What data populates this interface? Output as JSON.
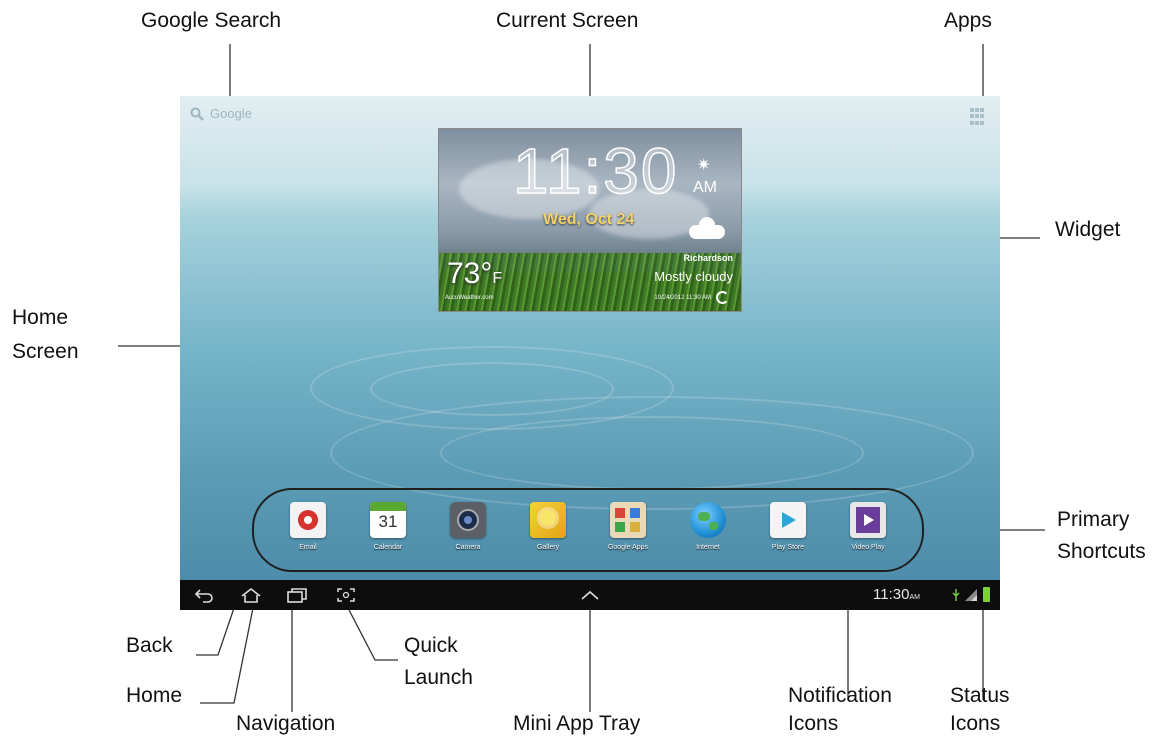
{
  "callouts": {
    "google_search": "Google Search",
    "current_screen": "Current Screen",
    "apps": "Apps",
    "widget": "Widget",
    "home_screen_1": "Home",
    "home_screen_2": "Screen",
    "primary_shortcuts_1": "Primary",
    "primary_shortcuts_2": "Shortcuts",
    "back": "Back",
    "home": "Home",
    "navigation": "Navigation",
    "quick_launch_1": "Quick",
    "quick_launch_2": "Launch",
    "mini_app_tray": "Mini App Tray",
    "notification_icons_1": "Notification",
    "notification_icons_2": "Icons",
    "status_icons_1": "Status",
    "status_icons_2": "Icons"
  },
  "screen": {
    "search_placeholder": "Google",
    "widget": {
      "time": "11:30",
      "ampm": "AM",
      "date": "Wed, Oct 24",
      "temperature": "73°",
      "unit": "F",
      "city": "Richardson",
      "condition": "Mostly cloudy",
      "source": "AccuWeather.com",
      "updated": "10/24/2012 11:30 AM"
    },
    "shortcuts": [
      {
        "label": "Email",
        "icon": "email-icon",
        "color": "#d8322e"
      },
      {
        "label": "Calendar",
        "icon": "calendar-icon",
        "color": "#ffffff",
        "day": "31"
      },
      {
        "label": "Camera",
        "icon": "camera-icon",
        "color": "#5b5f66"
      },
      {
        "label": "Gallery",
        "icon": "gallery-icon",
        "color": "#f0c419"
      },
      {
        "label": "Google Apps",
        "icon": "google-apps-folder-icon",
        "color": "#e9d9b7"
      },
      {
        "label": "Internet",
        "icon": "internet-globe-icon",
        "color": "#1f8fd6"
      },
      {
        "label": "Play Store",
        "icon": "play-store-icon",
        "color": "#f4f4f4"
      },
      {
        "label": "Video Play",
        "icon": "video-player-icon",
        "color": "#6a3c9c"
      }
    ],
    "status_bar": {
      "time": "11:30",
      "ampm": "AM"
    }
  }
}
